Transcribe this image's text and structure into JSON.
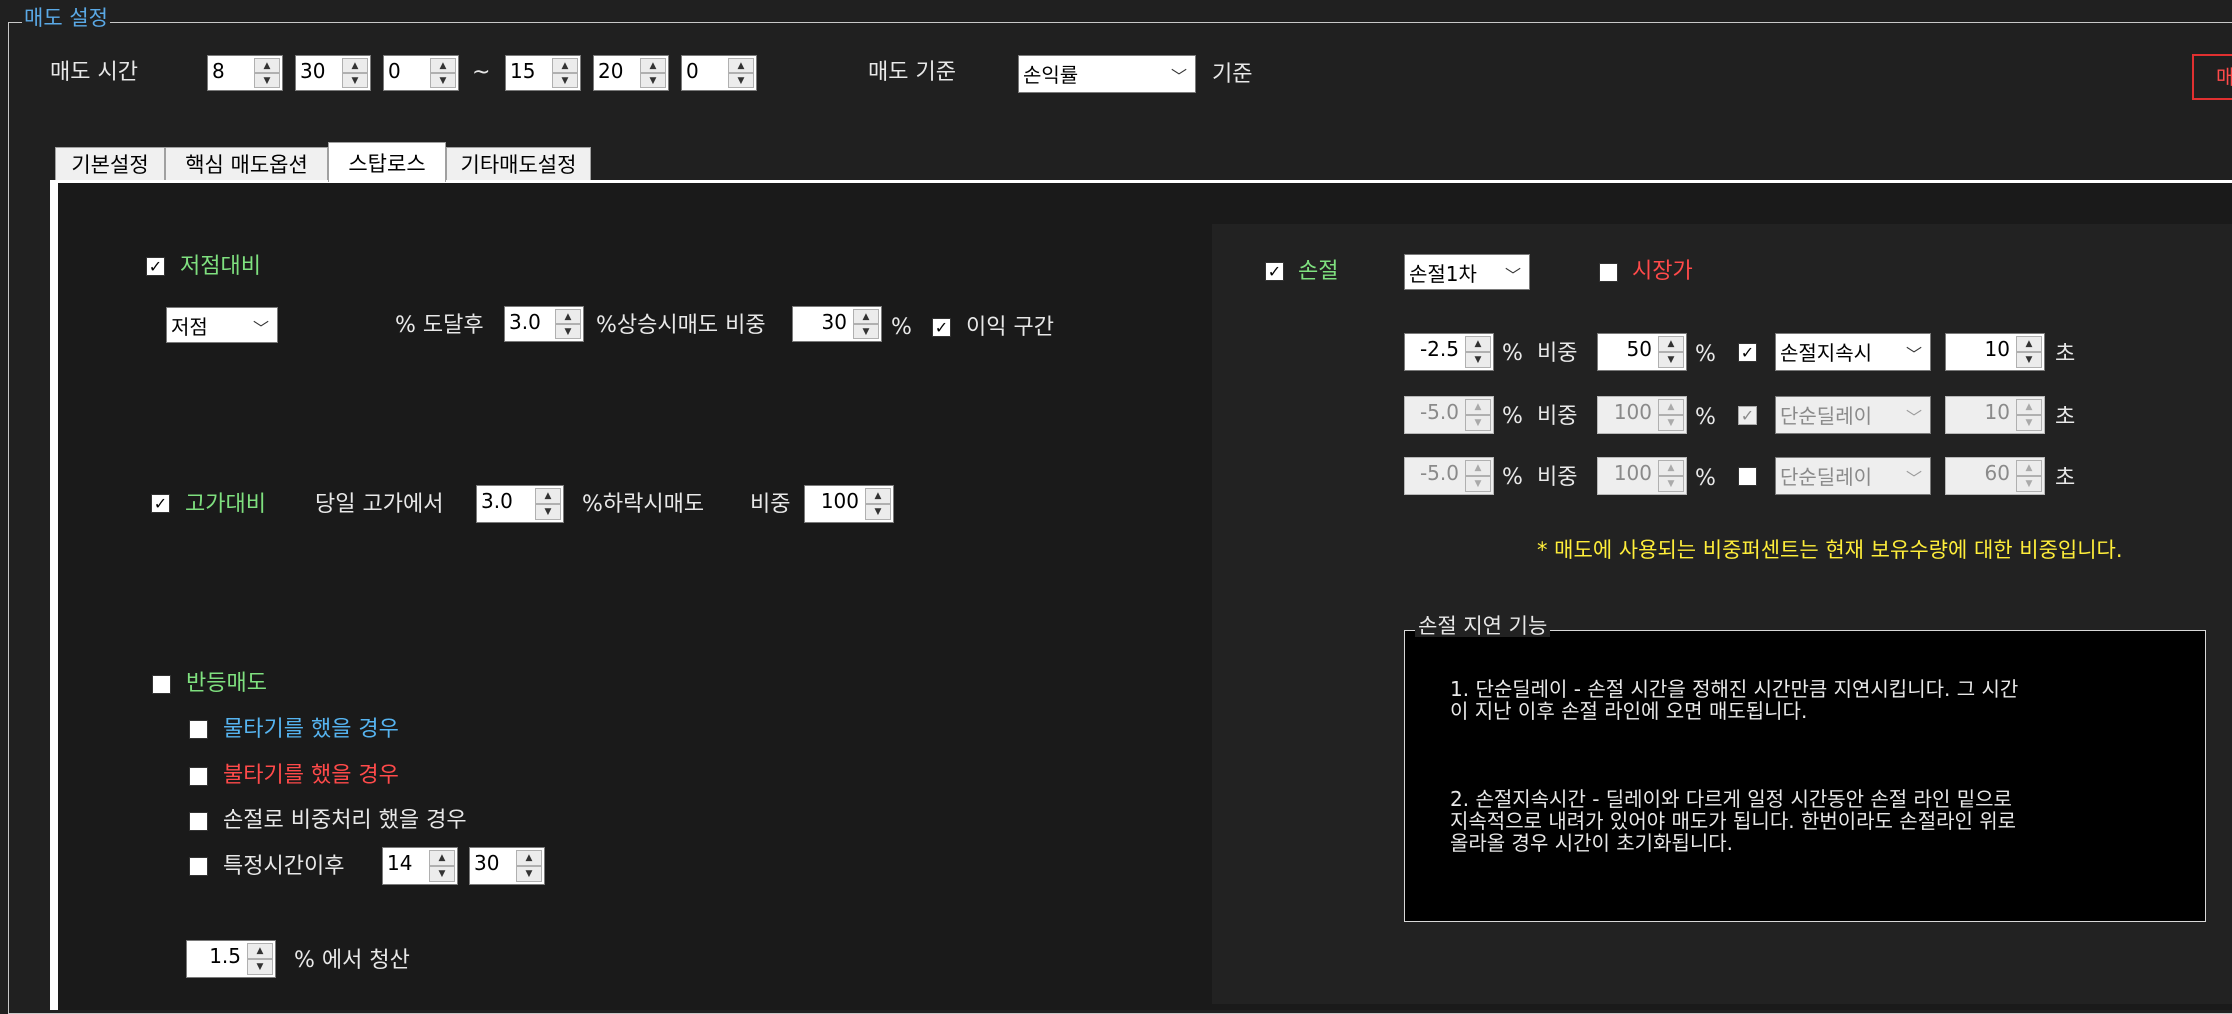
{
  "app": {
    "group_title": "매도 설정",
    "sell_time_label": "매도 시간",
    "time_start": {
      "hour": "8",
      "minute": "30",
      "second": "0"
    },
    "tilde": "~",
    "time_end": {
      "hour": "15",
      "minute": "20",
      "second": "0"
    },
    "sell_basis_label": "매도 기준",
    "sell_basis_value": "손익률",
    "basis_suffix": "기준",
    "right_button_label": "매"
  },
  "tabs": [
    {
      "label": "기본설정",
      "active": false
    },
    {
      "label": "핵심 매도옵션",
      "active": false
    },
    {
      "label": "스탑로스",
      "active": true
    },
    {
      "label": "기타매도설정",
      "active": false
    }
  ],
  "low": {
    "checked": true,
    "label": "저점대비",
    "select_value": "저점",
    "reach_label": "% 도달후",
    "pct_value": "3.0",
    "rise_label": "%상승시매도 비중",
    "weight_value": "30",
    "pct_sign": "%",
    "profit_zone_checked": true,
    "profit_zone_label": "이익 구간"
  },
  "high": {
    "checked": true,
    "label": "고가대비",
    "from_label": "당일 고가에서",
    "pct_value": "3.0",
    "drop_label": "%하락시매도",
    "weight_label": "비중",
    "weight_value": "100"
  },
  "rebound": {
    "checked": false,
    "label": "반등매도",
    "options": [
      {
        "label": "물타기를 했을 경우",
        "checked": false,
        "color": "#56b4f0"
      },
      {
        "label": "불타기를 했을 경우",
        "checked": false,
        "color": "#ff4a4a"
      },
      {
        "label": "손절로 비중처리 했을 경우",
        "checked": false,
        "color": "#e8e8e8"
      }
    ],
    "after_time": {
      "label": "특정시간이후",
      "checked": false,
      "hour": "14",
      "minute": "30"
    },
    "liquidate_pct": "1.5",
    "liquidate_label": "% 에서 청산"
  },
  "stoploss": {
    "checked": true,
    "label": "손절",
    "stage_value": "손절1차",
    "market_checked": false,
    "market_label": "시장가",
    "pct_sign": "%",
    "weight_label": "비중",
    "sec_label": "초",
    "rows": [
      {
        "pct": "-2.5",
        "weight": "50",
        "delay_checked": true,
        "delay_type": "손절지속시",
        "seconds": "10",
        "enabled": true
      },
      {
        "pct": "-5.0",
        "weight": "100",
        "delay_checked": true,
        "delay_type": "단순딜레이",
        "seconds": "10",
        "enabled": false
      },
      {
        "pct": "-5.0",
        "weight": "100",
        "delay_checked": false,
        "delay_type": "단순딜레이",
        "seconds": "60",
        "enabled": false
      }
    ],
    "note": "* 매도에 사용되는 비중퍼센트는 현재 보유수량에 대한 비중입니다."
  },
  "delay_box": {
    "title": "손절 지연 기능",
    "para1_line1": "1. 단순딜레이 - 손절 시간을 정해진 시간만큼 지연시킵니다. 그 시간",
    "para1_line2": "이 지난 이후 손절 라인에 오면 매도됩니다.",
    "para2_line1": "2. 손절지속시간 - 딜레이와 다르게 일정 시간동안 손절 라인 밑으로",
    "para2_line2": "지속적으로 내려가 있어야 매도가 됩니다. 한번이라도 손절라인 위로",
    "para2_line3": "올라올 경우 시간이 초기화됩니다."
  },
  "colors": {
    "background": "#202020",
    "accent_green": "#7fe07f",
    "accent_red": "#ff4a4a",
    "accent_blue": "#56b4f0",
    "note_yellow": "#ffee3a"
  }
}
